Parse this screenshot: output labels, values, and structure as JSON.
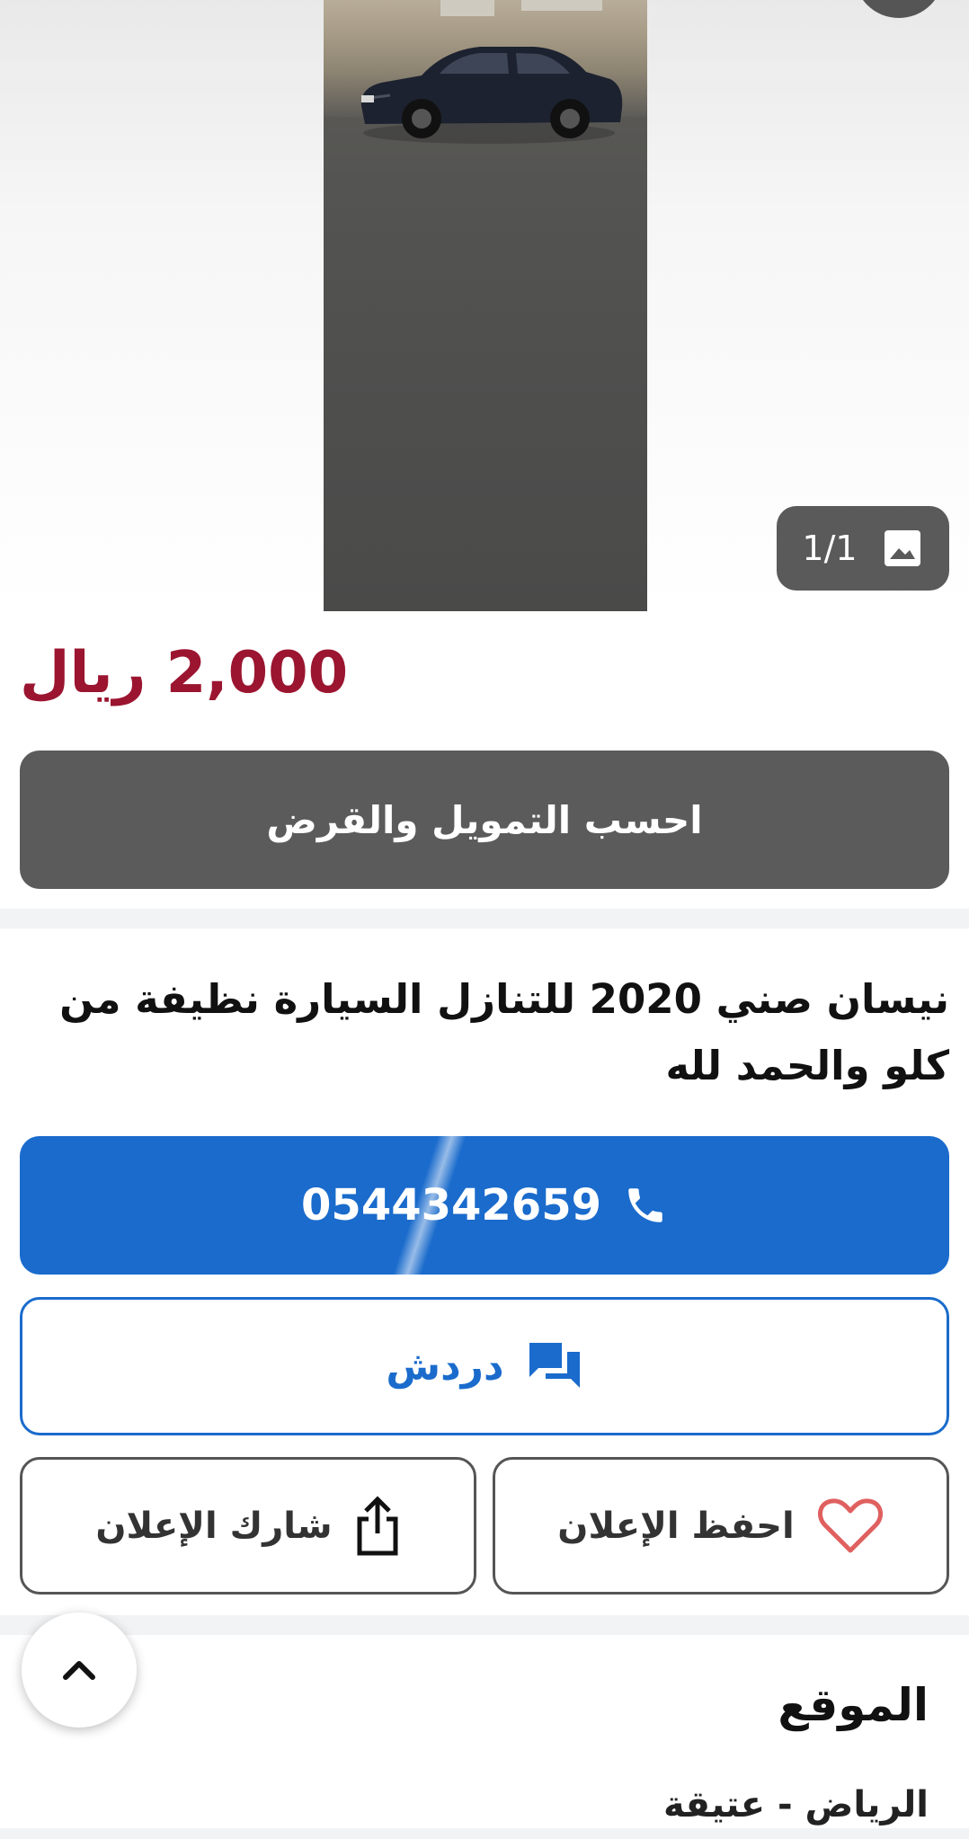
{
  "gallery": {
    "counter": "1/1",
    "icon": "image-icon"
  },
  "listing": {
    "price": "2,000 ريال",
    "finance_label": "احسب التمويل والقرض",
    "title": "نيسان صني 2020 للتنازل السيارة نظيفة من كلو والحمد لله"
  },
  "contact": {
    "phone": "0544342659",
    "phone_icon": "phone-icon",
    "chat_label": "دردش",
    "chat_icon": "chat-icon",
    "save_label": "احفظ الإعلان",
    "save_icon": "heart-icon",
    "share_label": "شارك الإعلان",
    "share_icon": "share-icon"
  },
  "location": {
    "heading": "الموقع",
    "value": "الرياض - عتيقة"
  },
  "colors": {
    "price": "#9b1530",
    "primary": "#1a6bcc",
    "finance_button": "#5b5b5b",
    "heart": "#e06060"
  }
}
